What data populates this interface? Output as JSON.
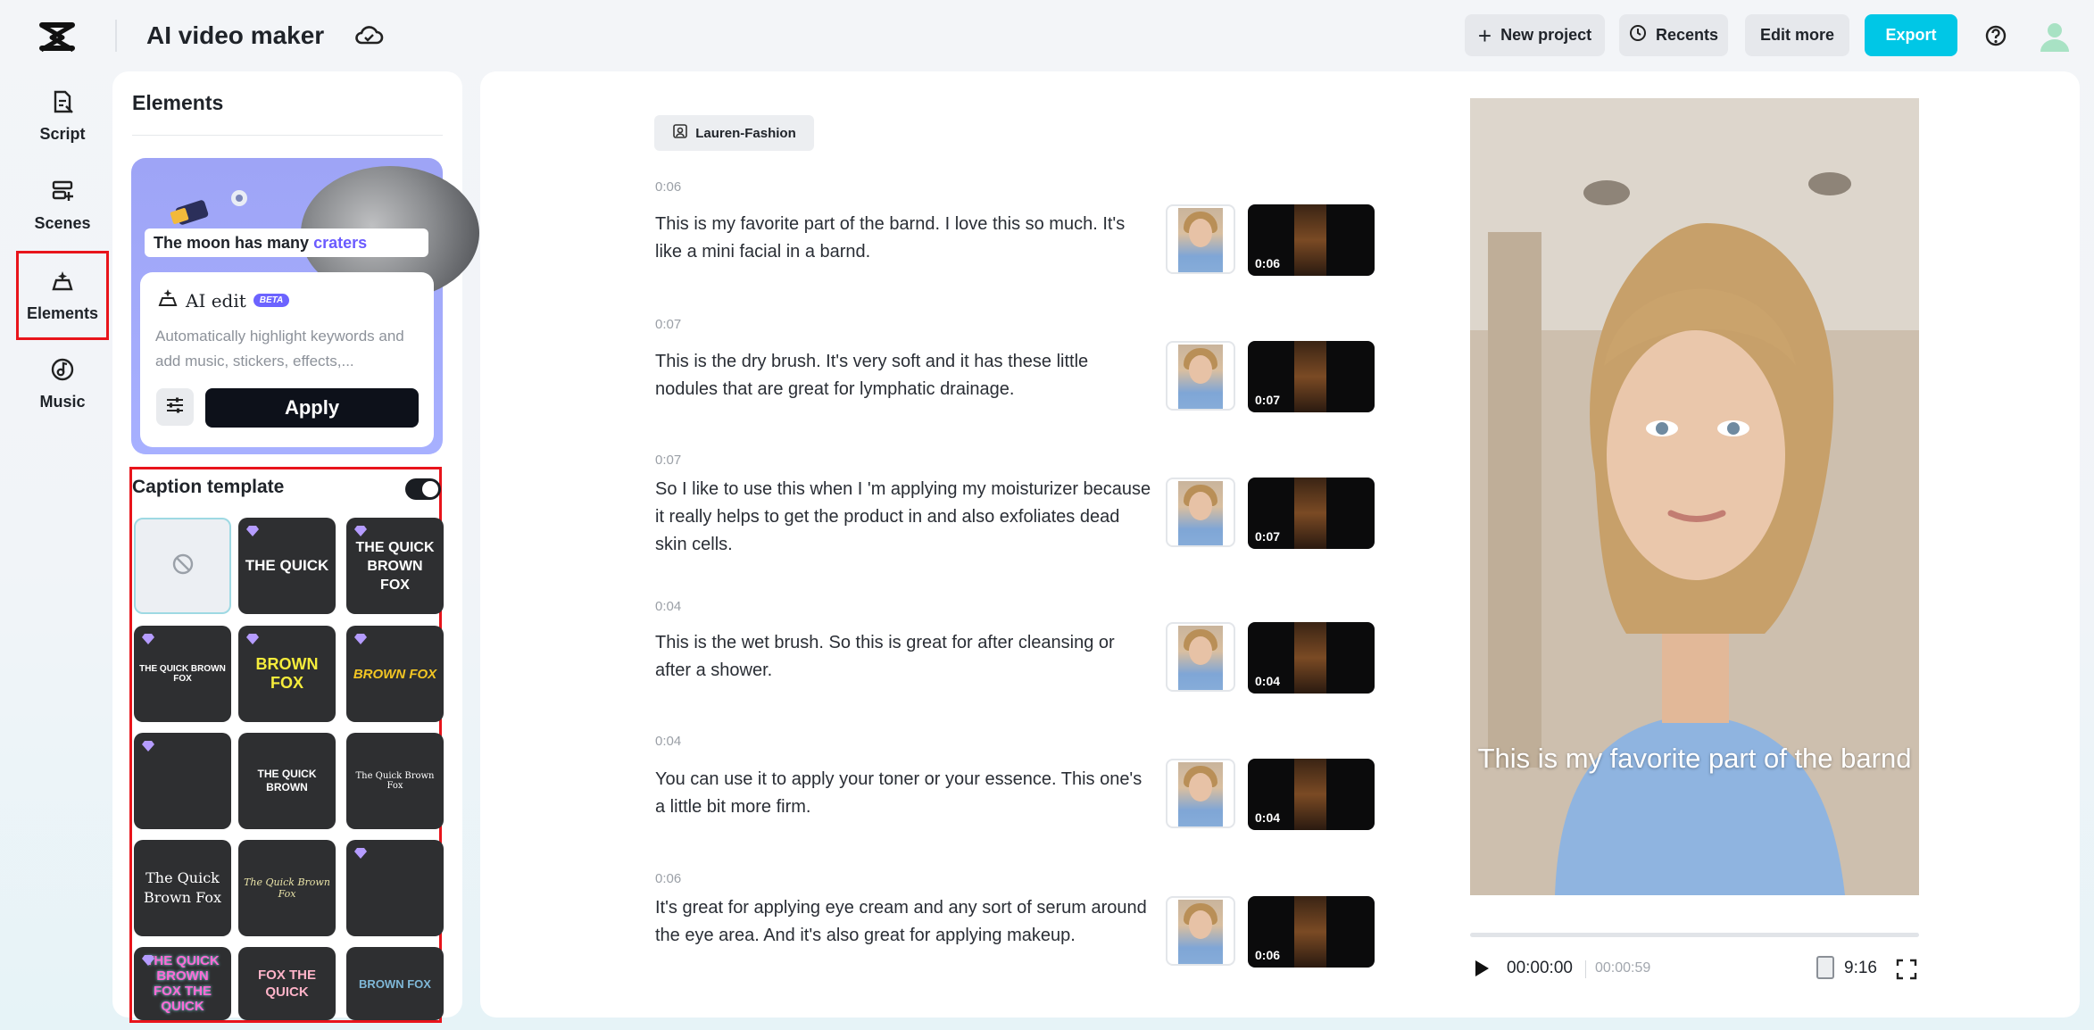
{
  "header": {
    "app_title": "AI video maker",
    "new_project": "New project",
    "recents": "Recents",
    "edit_more": "Edit more",
    "export": "Export"
  },
  "sidebar": {
    "items": [
      {
        "label": "Script",
        "icon": "script-icon"
      },
      {
        "label": "Scenes",
        "icon": "scenes-icon"
      },
      {
        "label": "Elements",
        "icon": "elements-icon",
        "active": true
      },
      {
        "label": "Music",
        "icon": "music-icon"
      }
    ]
  },
  "elements_panel": {
    "title": "Elements",
    "promo": {
      "caption_prefix": "The moon has many",
      "caption_highlight": "craters"
    },
    "ai_edit": {
      "title": "AI edit",
      "badge": "BETA",
      "description": "Automatically highlight keywords and add music, stickers, effects,...",
      "apply_label": "Apply"
    },
    "caption_template": {
      "title": "Caption template",
      "enabled": true,
      "tiles": [
        {
          "text": "",
          "style": "none"
        },
        {
          "text": "THE QUICK",
          "premium": true
        },
        {
          "text": "THE QUICK BROWN FOX",
          "premium": true
        },
        {
          "text": "THE QUICK BROWN FOX",
          "premium": true
        },
        {
          "text": "BROWN FOX",
          "premium": true
        },
        {
          "text": "BROWN FOX",
          "premium": true
        },
        {
          "text": "",
          "premium": true
        },
        {
          "text": "THE QUICK BROWN",
          "premium": false
        },
        {
          "text": "The Quick Brown Fox",
          "premium": false
        },
        {
          "text": "The Quick Brown Fox",
          "premium": false
        },
        {
          "text": "The Quick Brown Fox",
          "premium": false
        },
        {
          "text": "",
          "premium": true
        },
        {
          "text": "THE QUICK BROWN FOX THE QUICK",
          "premium": true
        },
        {
          "text": "FOX THE QUICK",
          "premium": false
        },
        {
          "text": "BROWN FOX",
          "premium": false
        }
      ]
    }
  },
  "script": {
    "speaker": "Lauren-Fashion",
    "lines": [
      {
        "time": "0:06",
        "text": "This is my favorite part of the barnd. I love this so much. It's like a mini facial in a barnd.",
        "clip": "0:06"
      },
      {
        "time": "0:07",
        "text": "This is the dry brush. It's very soft and it has these little nodules that are great for lymphatic drainage.",
        "clip": "0:07"
      },
      {
        "time": "0:07",
        "text": "So I like to use this when I 'm applying my moisturizer because it really helps to get the product in and also exfoliates dead skin cells.",
        "clip": "0:07"
      },
      {
        "time": "0:04",
        "text": "This is the wet brush. So this is great for after cleansing or after a shower.",
        "clip": "0:04"
      },
      {
        "time": "0:04",
        "text": "You can use it to apply your toner or your essence. This one's a little bit more firm.",
        "clip": "0:04"
      },
      {
        "time": "0:06",
        "text": "It's great for applying eye cream and any sort of serum around the eye area. And it's also great for applying makeup.",
        "clip": "0:06"
      }
    ]
  },
  "preview": {
    "caption": "This is my favorite part of the barnd",
    "current_time": "00:00:00",
    "total_time": "00:00:59",
    "aspect_ratio": "9:16"
  },
  "colors": {
    "accent": "#00c7e6",
    "highlight_box": "#e8141b",
    "apply_button": "#0d111a"
  }
}
